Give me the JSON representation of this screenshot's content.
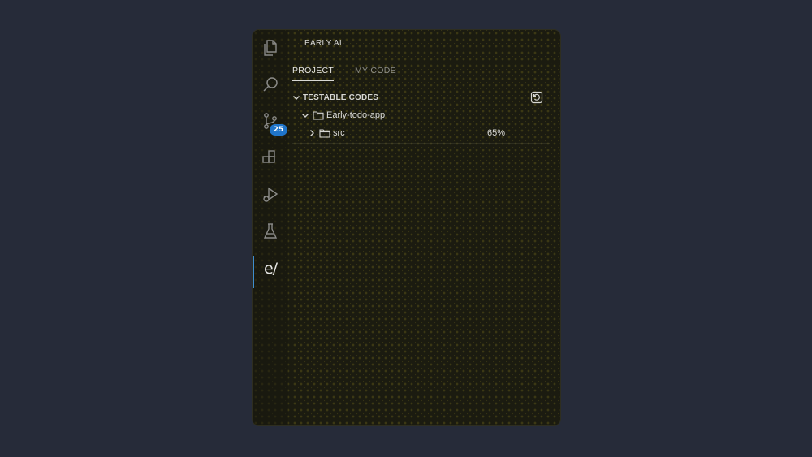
{
  "sidebar": {
    "title": "EARLY AI",
    "tabs": [
      {
        "label": "PROJECT",
        "active": true
      },
      {
        "label": "MY CODE",
        "active": false
      }
    ]
  },
  "activity_bar": {
    "items": [
      {
        "icon": "files-icon"
      },
      {
        "icon": "search-icon"
      },
      {
        "icon": "source-control-icon",
        "badge": "25"
      },
      {
        "icon": "extensions-icon"
      },
      {
        "icon": "run-debug-icon"
      },
      {
        "icon": "testing-flask-icon"
      },
      {
        "icon": "early-ai-logo",
        "text": "e/",
        "active": true
      }
    ]
  },
  "tree": {
    "section_title": "TESTABLE CODES",
    "project": {
      "name": "Early-todo-app",
      "expanded": true
    },
    "folders": [
      {
        "name": "src",
        "coverage": "65%",
        "expanded": false
      }
    ]
  },
  "colors": {
    "accent": "#3f8ccf",
    "badge": "#1f74c9",
    "panel_bg": "#1b1b10",
    "backdrop": "#262b39"
  }
}
